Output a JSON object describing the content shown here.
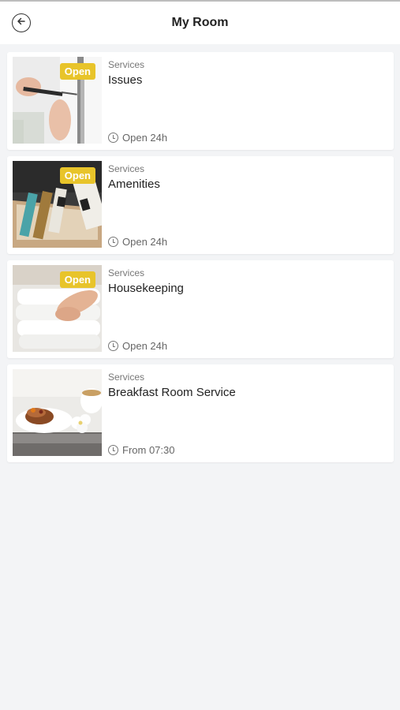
{
  "header": {
    "title": "My Room",
    "back_icon": "back-arrow-icon"
  },
  "services": [
    {
      "category": "Services",
      "name": "Issues",
      "badge": "Open",
      "hours": "Open 24h",
      "image": "screwdriver-repair-photo"
    },
    {
      "category": "Services",
      "name": "Amenities",
      "badge": "Open",
      "hours": "Open 24h",
      "image": "toiletries-box-photo"
    },
    {
      "category": "Services",
      "name": "Housekeeping",
      "badge": "Open",
      "hours": "Open 24h",
      "image": "folded-towels-photo"
    },
    {
      "category": "Services",
      "name": "Breakfast Room Service",
      "badge": "",
      "hours": "From 07:30",
      "image": "breakfast-tray-photo"
    }
  ],
  "colors": {
    "badge": "#e8c42a",
    "background": "#f3f4f6"
  }
}
